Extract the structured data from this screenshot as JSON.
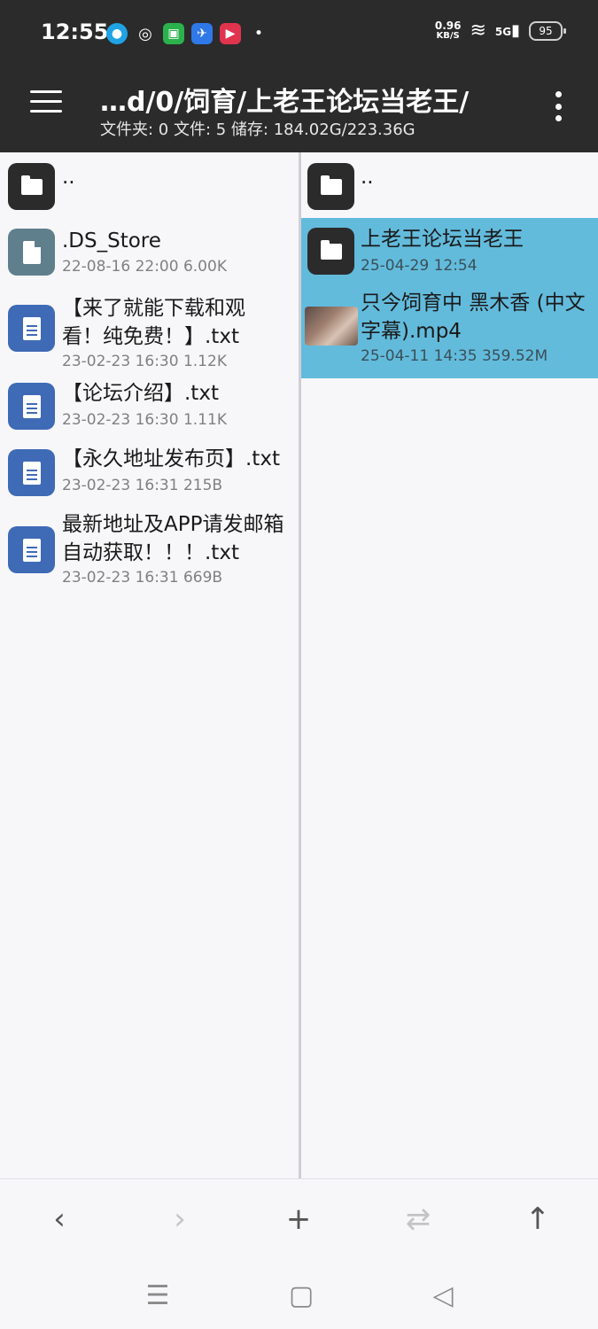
{
  "status_bar": {
    "time": "12:55",
    "net_speed_value": "0.96",
    "net_speed_unit": "KB/S",
    "network": "5G",
    "battery": "95",
    "app_icons": [
      "qq-icon",
      "wechat-icon",
      "green-app-icon",
      "blue-app-icon",
      "red-play-icon",
      "dot-icon"
    ]
  },
  "header": {
    "path": "…d/0/饲育/上老王论坛当老王/",
    "summary": "文件夹: 0  文件: 5  储存: 184.02G/223.36G"
  },
  "left_pane": {
    "parent": "..",
    "items": [
      {
        "name": ".DS_Store",
        "meta": "22-08-16 22:00  6.00K",
        "icon": "file-icon"
      },
      {
        "name": "【来了就能下载和观看！纯免费！】.txt",
        "meta": "23-02-23 16:30  1.12K",
        "icon": "text-file-icon"
      },
      {
        "name": "【论坛介绍】.txt",
        "meta": "23-02-23 16:30  1.11K",
        "icon": "text-file-icon"
      },
      {
        "name": "【永久地址发布页】.txt",
        "meta": "23-02-23 16:31  215B",
        "icon": "text-file-icon"
      },
      {
        "name": "最新地址及APP请发邮箱自动获取！！！.txt",
        "meta": "23-02-23 16:31  669B",
        "icon": "text-file-icon"
      }
    ]
  },
  "right_pane": {
    "parent": "..",
    "items": [
      {
        "name": "上老王论坛当老王",
        "meta": "25-04-29 12:54",
        "icon": "folder-icon"
      },
      {
        "name": "只今饲育中  黑木香 (中文字幕).mp4",
        "meta": "25-04-11 14:35  359.52M",
        "icon": "video-thumbnail"
      }
    ]
  },
  "toolbar": {
    "back": "‹",
    "forward": "›",
    "add": "+",
    "swap": "⇄",
    "up": "↑"
  },
  "system_nav": {
    "menu": "☰",
    "home": "▢",
    "back": "◁"
  },
  "colors": {
    "header_bg": "#2b2b2b",
    "selection": "#63bbdc",
    "doc_icon": "#3f6ab6"
  }
}
